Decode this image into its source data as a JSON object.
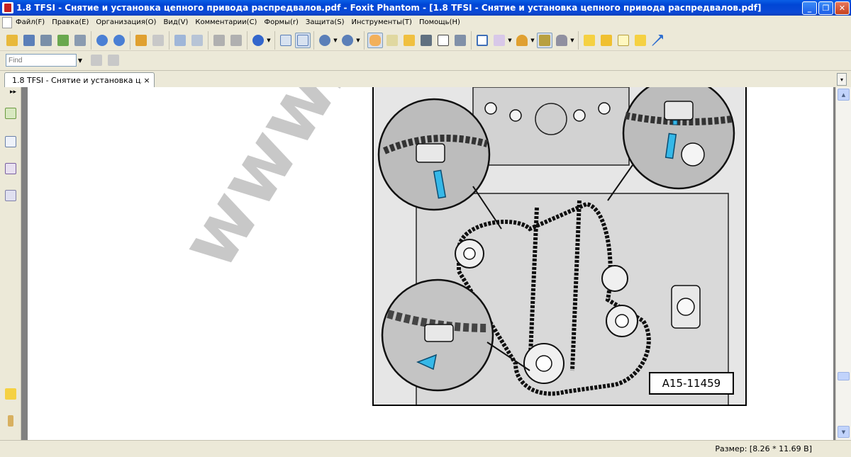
{
  "window": {
    "title": "1.8 TFSI - Снятие и установка цепного привода распредвалов.pdf - Foxit Phantom - [1.8 TFSI - Снятие и установка цепного привода распредвалов.pdf]",
    "minimize": "_",
    "restore": "❐",
    "close": "✕"
  },
  "menu": {
    "items": [
      {
        "label": "Файл(F)"
      },
      {
        "label": "Правка(E)"
      },
      {
        "label": "Организация(O)"
      },
      {
        "label": "Вид(V)"
      },
      {
        "label": "Комментарии(C)"
      },
      {
        "label": "Формы(r)"
      },
      {
        "label": "Защита(S)"
      },
      {
        "label": "Инструменты(T)"
      },
      {
        "label": "Помощь(H)"
      }
    ]
  },
  "toolbar": {
    "colors": {
      "open": "#e8b93c",
      "print": "#5b7fb8",
      "email": "#6aa84f",
      "nav": "#4a7fd4",
      "arrow": "#e0a030",
      "zoom": "#3366cc",
      "hand": "#f2b05a",
      "text": "#444444",
      "note": "#f5d142",
      "link": "#2f6fd0"
    }
  },
  "find": {
    "placeholder": "Find"
  },
  "tabs": {
    "active": {
      "label": "1.8 TFSI - Снятие и установка ц...",
      "close": "×"
    },
    "menu_arrow": "▾"
  },
  "nav": {
    "expand": "▸▸"
  },
  "document": {
    "watermark": "www.",
    "figure_label": "A15-11459"
  },
  "status": {
    "page_size": "Размер: [8.26 * 11.69 В]"
  }
}
